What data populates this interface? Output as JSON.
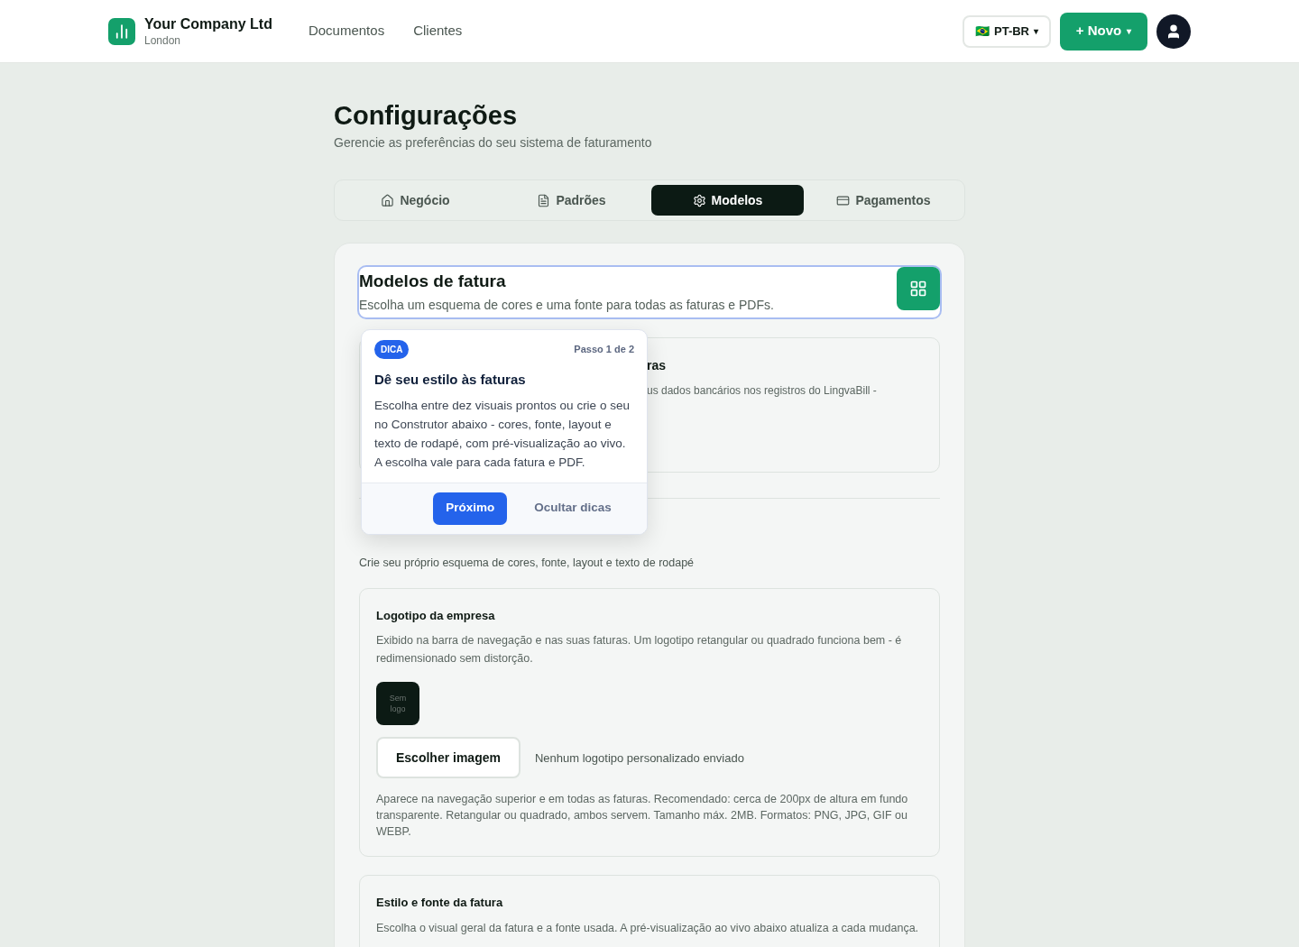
{
  "header": {
    "company": "Your Company Ltd",
    "location": "London",
    "nav": [
      {
        "label": "Documentos"
      },
      {
        "label": "Clientes"
      }
    ],
    "language": {
      "flag": "🇧🇷",
      "label": "PT-BR",
      "caret": "▾"
    },
    "new_button": {
      "label": "+ Novo",
      "caret": "▾"
    }
  },
  "page": {
    "title": "Configurações",
    "subtitle": "Gerencie as preferências do seu sistema de faturamento"
  },
  "tabs": [
    {
      "label": "Negócio",
      "kind": "home",
      "selected": false
    },
    {
      "label": "Padrões",
      "kind": "file",
      "selected": false
    },
    {
      "label": "Modelos",
      "kind": "gear",
      "selected": true
    },
    {
      "label": "Pagamentos",
      "kind": "card",
      "selected": false
    }
  ],
  "section": {
    "title": "Modelos de fatura",
    "description": "Escolha um esquema de cores e uma fonte para todas as faturas e PDFs.",
    "highlighted": true
  },
  "covered_card": {
    "title": "ras",
    "text": "us dados bancários nos registros do LingvaBill -"
  },
  "builder_caption": "Crie seu próprio esquema de cores, fonte, layout e texto de rodapé",
  "logo_card": {
    "title": "Logotipo da empresa",
    "description": "Exibido na barra de navegação e nas suas faturas. Um logotipo retangular ou quadrado funciona bem - é redimensionado sem distorção.",
    "placeholder": "Sem logo",
    "button": "Escolher imagem",
    "status": "Nenhum logotipo personalizado enviado",
    "help": "Aparece na navegação superior e em todas as faturas. Recomendado: cerca de 200px de altura em fundo transparente. Retangular ou quadrado, ambos servem. Tamanho máx. 2MB. Formatos: PNG, JPG, GIF ou WEBP."
  },
  "style_card": {
    "title": "Estilo e fonte da fatura",
    "description": "Escolha o visual geral da fatura e a fonte usada. A pré-visualização ao vivo abaixo atualiza a cada mudança."
  },
  "tip": {
    "badge": "DICA",
    "step": "Passo 1 de 2",
    "title": "Dê seu estilo às faturas",
    "text": "Escolha entre dez visuais prontos ou crie o seu no Construtor abaixo - cores, fonte, layout e texto de rodapé, com pré-visualização ao vivo. A escolha vale para cada fatura e PDF.",
    "next": "Próximo",
    "hide": "Ocultar dicas"
  }
}
